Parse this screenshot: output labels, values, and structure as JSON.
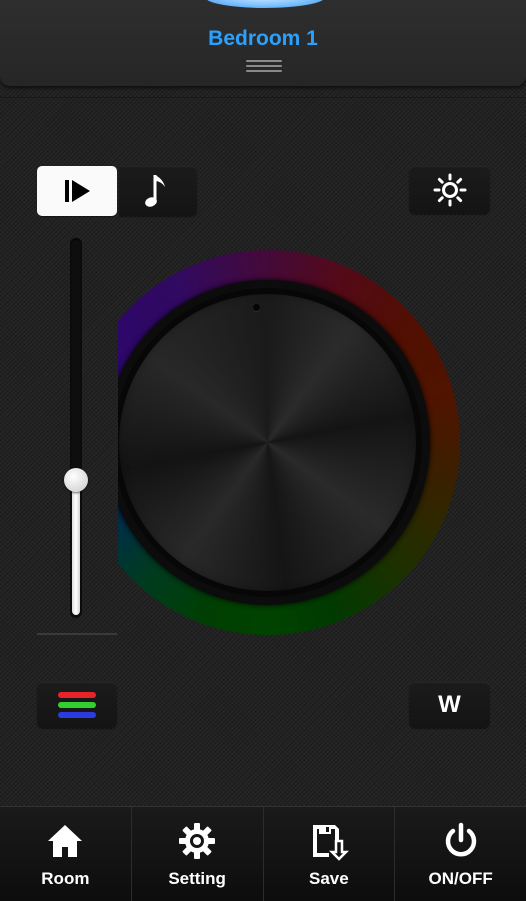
{
  "header": {
    "room_name": "Bedroom 1"
  },
  "mode_buttons": {
    "play": "play-icon",
    "music": "music-note-icon"
  },
  "brightness_button": {
    "icon": "sun-icon"
  },
  "slider": {
    "level": 0.36
  },
  "color_wheel": {
    "knob": "color-knob"
  },
  "rgb_button": {
    "colors": [
      "#e8232a",
      "#2fd02f",
      "#2a3ce0"
    ]
  },
  "white_button": {
    "label": "W"
  },
  "tabbar": {
    "tabs": [
      {
        "label": "Room",
        "icon": "home-icon"
      },
      {
        "label": "Setting",
        "icon": "gear-icon"
      },
      {
        "label": "Save",
        "icon": "save-icon"
      },
      {
        "label": "ON/OFF",
        "icon": "power-icon"
      }
    ]
  },
  "accent_color": "#2aa1ff"
}
